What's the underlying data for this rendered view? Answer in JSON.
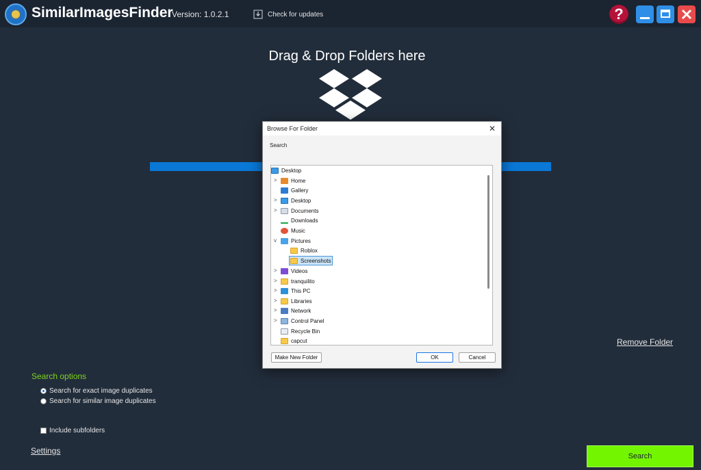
{
  "app": {
    "title": "SimilarImagesFinder",
    "version": "Version: 1.0.2.1",
    "check_updates": "Check for updates",
    "help_symbol": "?"
  },
  "main": {
    "drop_title": "Drag & Drop Folders here",
    "remove_folder": "Remove Folder"
  },
  "search_options": {
    "title": "Search options",
    "exact": "Search for exact image duplicates",
    "similar": "Search for similar image duplicates",
    "selected": "exact",
    "include_subfolders": "Include subfolders",
    "include_subfolders_checked": false
  },
  "footer": {
    "settings": "Settings",
    "search_button": "Search"
  },
  "dialog": {
    "title": "Browse For Folder",
    "close_symbol": "✕",
    "description": "Search",
    "tree": [
      {
        "label": "Desktop",
        "icon": "desktop-icon",
        "expander": "",
        "selected": false
      },
      {
        "label": "Home",
        "icon": "home-icon",
        "expander": ">",
        "selected": false
      },
      {
        "label": "Gallery",
        "icon": "gallery-icon",
        "expander": "",
        "selected": false
      },
      {
        "label": "Desktop",
        "icon": "desktop-icon",
        "expander": ">",
        "selected": false
      },
      {
        "label": "Documents",
        "icon": "documents-icon",
        "expander": ">",
        "selected": false
      },
      {
        "label": "Downloads",
        "icon": "downloads-icon",
        "expander": "",
        "selected": false
      },
      {
        "label": "Music",
        "icon": "music-icon",
        "expander": "",
        "selected": false
      },
      {
        "label": "Pictures",
        "icon": "pictures-icon",
        "expander": "v",
        "selected": false
      },
      {
        "label": "Roblox",
        "icon": "folder-icon",
        "expander": "",
        "selected": false
      },
      {
        "label": "Screenshots",
        "icon": "folder-icon",
        "expander": "",
        "selected": true
      },
      {
        "label": "Videos",
        "icon": "videos-icon",
        "expander": ">",
        "selected": false
      },
      {
        "label": "tranquilito",
        "icon": "folder-icon",
        "expander": ">",
        "selected": false
      },
      {
        "label": "This PC",
        "icon": "this-pc-icon",
        "expander": ">",
        "selected": false
      },
      {
        "label": "Libraries",
        "icon": "libraries-icon",
        "expander": ">",
        "selected": false
      },
      {
        "label": "Network",
        "icon": "network-icon",
        "expander": ">",
        "selected": false
      },
      {
        "label": "Control Panel",
        "icon": "control-panel-icon",
        "expander": ">",
        "selected": false
      },
      {
        "label": "Recycle Bin",
        "icon": "recycle-bin-icon",
        "expander": "",
        "selected": false
      },
      {
        "label": "capcut",
        "icon": "folder-icon",
        "expander": "",
        "selected": false
      }
    ],
    "buttons": {
      "new_folder": "Make New Folder",
      "ok": "OK",
      "cancel": "Cancel"
    }
  },
  "colors": {
    "background": "#222d3b",
    "titlebar": "#1b2431",
    "accent_green": "#7ed321",
    "search_button": "#73f500",
    "progress_blue": "#0a78d6"
  }
}
